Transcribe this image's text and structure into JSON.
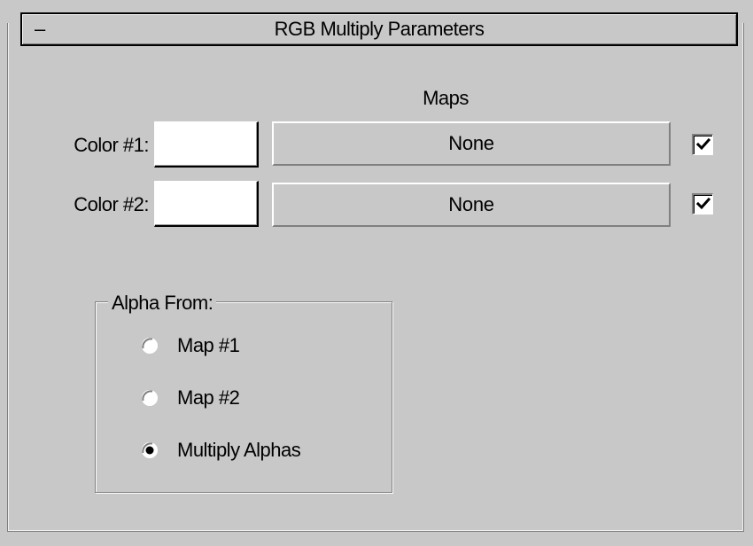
{
  "rollout": {
    "toggle": "–",
    "title": "RGB Multiply Parameters"
  },
  "maps_heading": "Maps",
  "rows": [
    {
      "label": "Color #1:",
      "swatch_color": "#ffffff",
      "map_label": "None",
      "enabled": true
    },
    {
      "label": "Color #2:",
      "swatch_color": "#ffffff",
      "map_label": "None",
      "enabled": true
    }
  ],
  "alpha_from": {
    "legend": "Alpha From:",
    "options": [
      {
        "label": "Map #1",
        "selected": false
      },
      {
        "label": "Map #2",
        "selected": false
      },
      {
        "label": "Multiply Alphas",
        "selected": true
      }
    ]
  },
  "icons": {
    "checkmark": "checkmark-icon",
    "radio_off": "radio-unselected-icon",
    "radio_on": "radio-selected-icon"
  },
  "colors": {
    "panel_bg": "#c8c8c8",
    "swatch": "#ffffff"
  }
}
